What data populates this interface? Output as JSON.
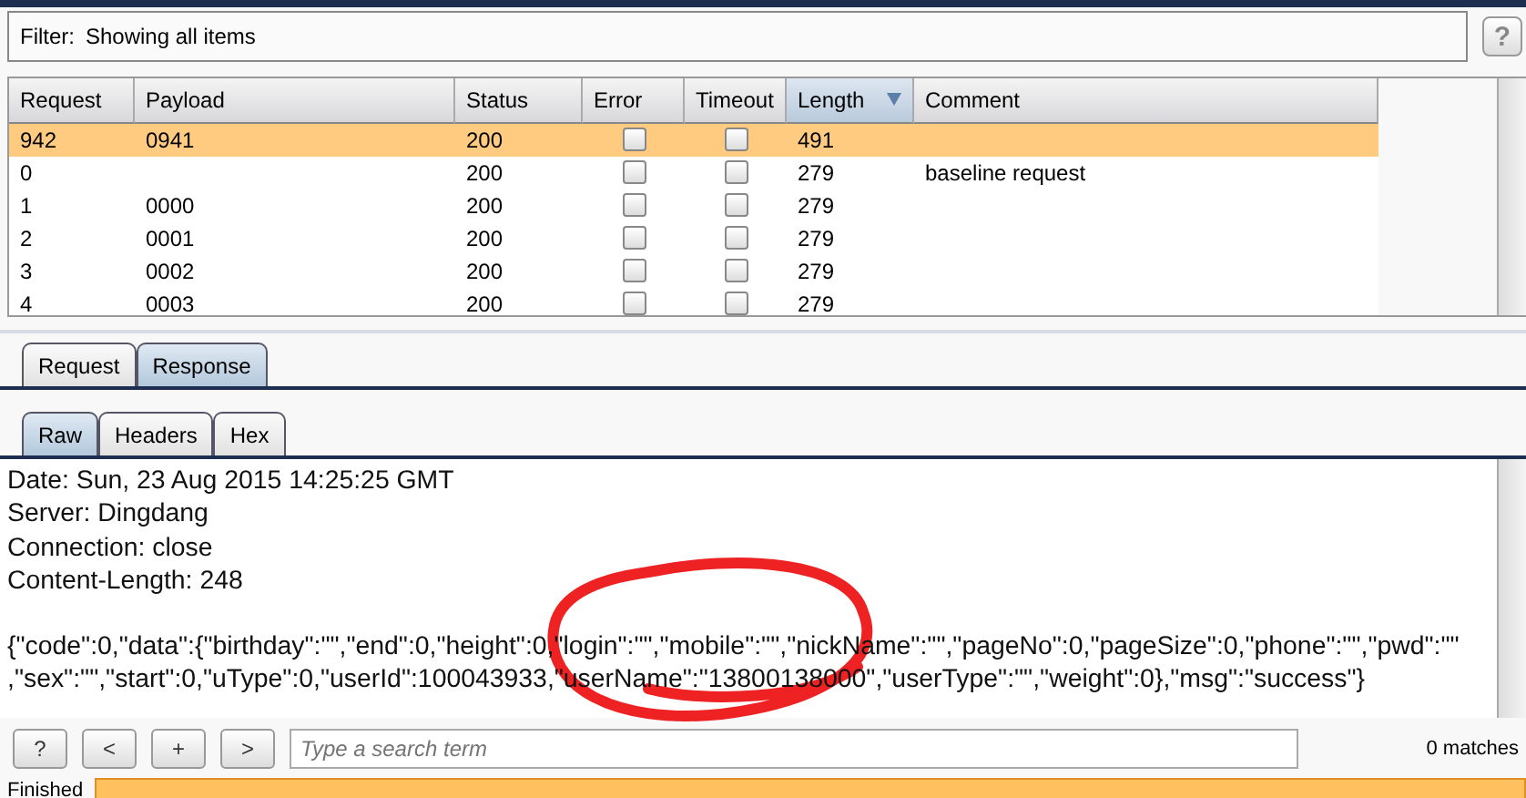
{
  "filter": {
    "label": "Filter:",
    "value": "Showing all items",
    "help": "?"
  },
  "table": {
    "columns": [
      {
        "label": "Request",
        "sorted": false
      },
      {
        "label": "Payload",
        "sorted": false
      },
      {
        "label": "Status",
        "sorted": false
      },
      {
        "label": "Error",
        "sorted": false
      },
      {
        "label": "Timeout",
        "sorted": false
      },
      {
        "label": "Length",
        "sorted": true
      },
      {
        "label": "Comment",
        "sorted": false
      }
    ],
    "rows": [
      {
        "request": "942",
        "payload": "0941",
        "status": "200",
        "error": false,
        "timeout": false,
        "length": "491",
        "comment": "",
        "selected": true
      },
      {
        "request": "0",
        "payload": "",
        "status": "200",
        "error": false,
        "timeout": false,
        "length": "279",
        "comment": "baseline request",
        "selected": false
      },
      {
        "request": "1",
        "payload": "0000",
        "status": "200",
        "error": false,
        "timeout": false,
        "length": "279",
        "comment": "",
        "selected": false
      },
      {
        "request": "2",
        "payload": "0001",
        "status": "200",
        "error": false,
        "timeout": false,
        "length": "279",
        "comment": "",
        "selected": false
      },
      {
        "request": "3",
        "payload": "0002",
        "status": "200",
        "error": false,
        "timeout": false,
        "length": "279",
        "comment": "",
        "selected": false
      },
      {
        "request": "4",
        "payload": "0003",
        "status": "200",
        "error": false,
        "timeout": false,
        "length": "279",
        "comment": "",
        "selected": false
      }
    ]
  },
  "message_tabs": [
    {
      "label": "Request",
      "selected": false
    },
    {
      "label": "Response",
      "selected": true
    }
  ],
  "view_tabs": [
    {
      "label": "Raw",
      "selected": true
    },
    {
      "label": "Headers",
      "selected": false
    },
    {
      "label": "Hex",
      "selected": false
    }
  ],
  "response_headers": [
    "Date: Sun, 23 Aug 2015 14:25:25 GMT",
    "Server: Dingdang",
    "Connection: close",
    "Content-Length: 248"
  ],
  "response_body": [
    "{\"code\":0,\"data\":{\"birthday\":\"\",\"end\":0,\"height\":0,\"login\":\"\",\"mobile\":\"\",\"nickName\":\"\",\"pageNo\":0,\"pageSize\":0,\"phone\":\"\",\"pwd\":\"\"",
    ",\"sex\":\"\",\"start\":0,\"uType\":0,\"userId\":100043933,\"userName\":\"13800138000\",\"userType\":\"\",\"weight\":0},\"msg\":\"success\"}"
  ],
  "search": {
    "buttons": [
      "?",
      "<",
      "+",
      ">"
    ],
    "placeholder": "Type a search term",
    "matches": "0 matches"
  },
  "status_bar": {
    "text": "Finished",
    "level": 1
  }
}
